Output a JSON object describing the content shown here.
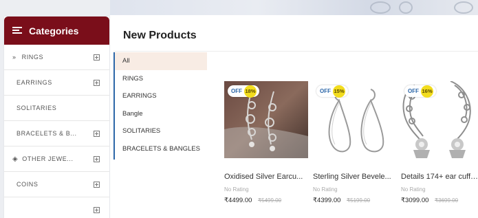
{
  "categories": {
    "title": "Categories",
    "items": [
      {
        "label": "RINGS"
      },
      {
        "label": "EARRINGS"
      },
      {
        "label": "SOLITARIES"
      },
      {
        "label": "BRACELETS & B..."
      },
      {
        "label": "OTHER JEWE..."
      },
      {
        "label": "COINS"
      },
      {
        "label": ""
      }
    ]
  },
  "main": {
    "title": "New Products",
    "filters": [
      "All",
      "RINGS",
      "EARRINGS",
      "Bangle",
      "SOLITARIES",
      "BRACELETS & BANGLES"
    ],
    "active_filter": "All"
  },
  "products": [
    {
      "name": "Oxidised Silver Earcu...",
      "discount_prefix": "OFF",
      "discount": "18%",
      "rating": "No Rating",
      "price": "₹4499.00",
      "old_price": "₹5499.00"
    },
    {
      "name": "Sterling Silver Bevele...",
      "discount_prefix": "OFF",
      "discount": "15%",
      "rating": "No Rating",
      "price": "₹4399.00",
      "old_price": "₹5199.00"
    },
    {
      "name": "Details 174+ ear cuff ...",
      "discount_prefix": "OFF",
      "discount": "16%",
      "rating": "No Rating",
      "price": "₹3099.00",
      "old_price": "₹3699.00"
    }
  ],
  "colors": {
    "header_bg": "#7a0e1a",
    "accent_blue": "#2b66a8",
    "badge_yellow": "#f2dc1e",
    "active_filter_bg": "#f8ece4"
  }
}
